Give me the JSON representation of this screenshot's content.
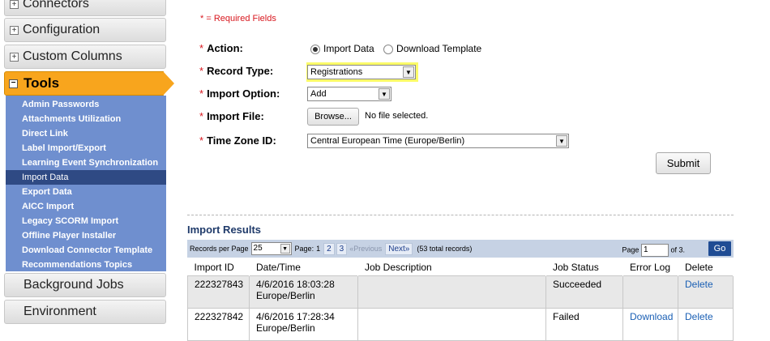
{
  "sidebar": {
    "connectors": "Connectors",
    "configuration": "Configuration",
    "custom_columns": "Custom Columns",
    "tools": "Tools",
    "background_jobs": "Background Jobs",
    "environment": "Environment",
    "tools_items": [
      "Admin Passwords",
      "Attachments Utilization",
      "Direct Link",
      "Label Import/Export",
      "Learning Event Synchronization",
      "Import Data",
      "Export Data",
      "AICC Import",
      "Legacy SCORM Import",
      "Offline Player Installer",
      "Download Connector Template",
      "Recommendations Topics"
    ],
    "selected_item": "Import Data"
  },
  "form": {
    "required_note": "* = Required Fields",
    "required_star": "*",
    "action_label": "Action:",
    "action_options": [
      "Import Data",
      "Download Template"
    ],
    "action_selected": "Import Data",
    "record_type_label": "Record Type:",
    "record_type_value": "Registrations",
    "import_option_label": "Import Option:",
    "import_option_value": "Add",
    "import_file_label": "Import File:",
    "browse_label": "Browse...",
    "file_status": "No file selected.",
    "timezone_label": "Time Zone ID:",
    "timezone_value": "Central European Time (Europe/Berlin)",
    "submit_label": "Submit"
  },
  "results": {
    "title": "Import Results",
    "records_per_page_label": "Records per Page",
    "records_per_page_value": "25",
    "page_label": "Page:",
    "pages": [
      "1",
      "2",
      "3"
    ],
    "prev_label": "«Previous",
    "next_label": "Next»",
    "total_records": "(53 total records)",
    "page_input_label": "Page",
    "page_input_value": "1",
    "page_of": "of 3.",
    "go_label": "Go",
    "columns": [
      "Import ID",
      "Date/Time",
      "Job Description",
      "Job Status",
      "Error Log",
      "Delete"
    ],
    "rows": [
      {
        "id": "222327843",
        "date": "4/6/2016 18:03:28",
        "tz": "Europe/Berlin",
        "desc": "",
        "status": "Succeeded",
        "error_log": "",
        "delete": "Delete"
      },
      {
        "id": "222327842",
        "date": "4/6/2016 17:28:34",
        "tz": "Europe/Berlin",
        "desc": "",
        "status": "Failed",
        "error_log": "Download",
        "delete": "Delete"
      }
    ]
  },
  "colors": {
    "accent": "#f8a51d",
    "submenu": "#6f8fcf",
    "highlight": "#fbfb68",
    "required": "#d8171e"
  }
}
